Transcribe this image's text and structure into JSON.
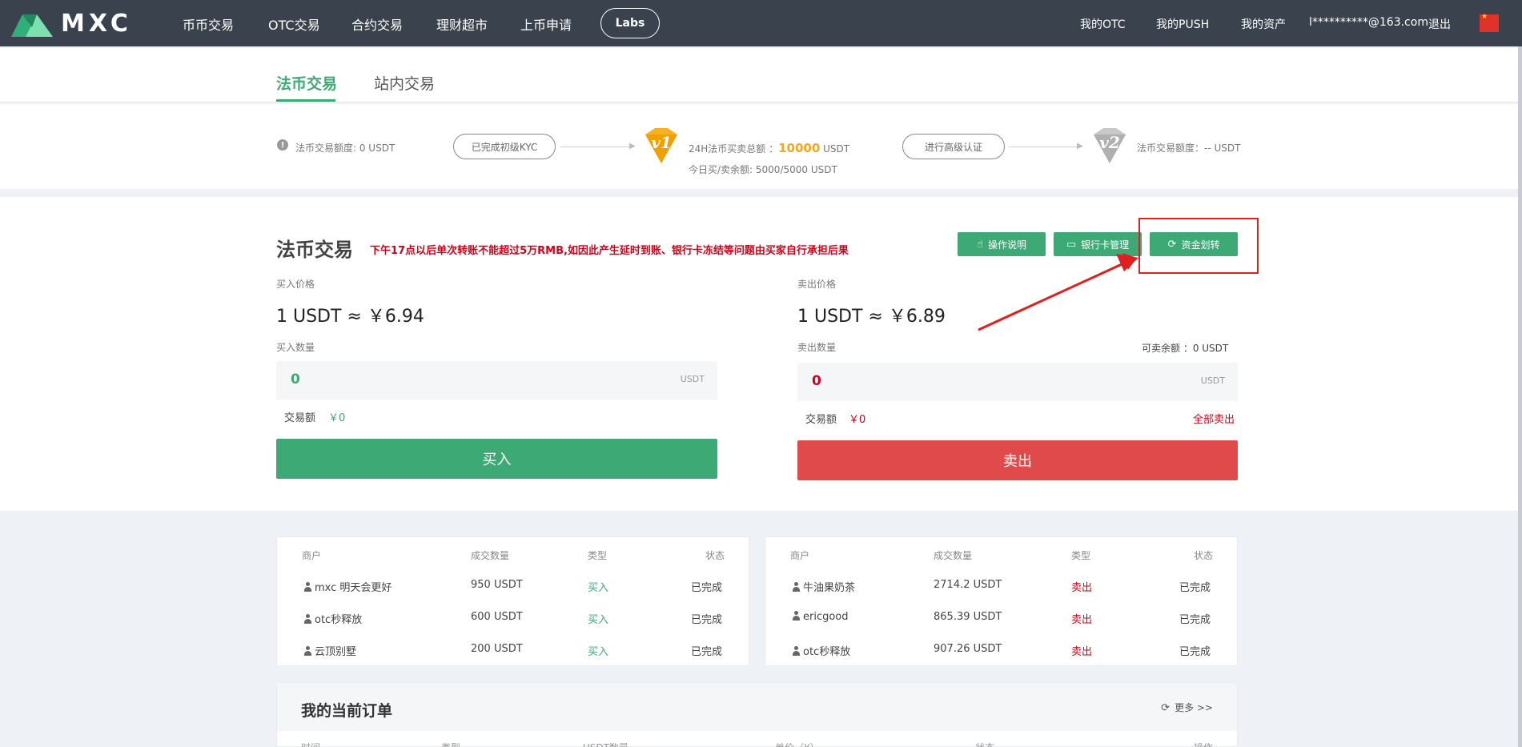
{
  "nav": {
    "logo_text": "MXC",
    "items": [
      "币币交易",
      "OTC交易",
      "合约交易",
      "理财超市",
      "上币申请"
    ],
    "labs": "Labs",
    "right": [
      "我的OTC",
      "我的PUSH",
      "我的资产",
      "l**********@163.com",
      "退出"
    ]
  },
  "tabs": {
    "fiat": "法币交易",
    "internal": "站内交易"
  },
  "kyc": {
    "limit_text": "法币交易额度: 0 USDT",
    "kyc_done": "已完成初级KYC",
    "v1": "v1",
    "total_label": "24H法币买卖总额 ：",
    "total_amount": "10000",
    "total_unit": "USDT",
    "remaining": "今日买/卖余额: 5000/5000 USDT",
    "advanced": "进行高级认证",
    "v2": "v2",
    "v2_limit": "法币交易额度：-- USDT"
  },
  "trade": {
    "title": "法币交易",
    "notice": "下午17点以后单次转账不能超过5万RMB,如因此产生延时到账、银行卡冻结等问题由买家自行承担后果",
    "btn_guide": "操作说明",
    "btn_bank": "银行卡管理",
    "btn_transfer": "资金划转",
    "buy": {
      "price_label": "买入价格",
      "price": "1 USDT ≈ ￥6.94",
      "qty_label": "买入数量",
      "qty_value": "0",
      "unit": "USDT",
      "amount_label": "交易额",
      "amount_value": "￥0",
      "button": "买入"
    },
    "sell": {
      "price_label": "卖出价格",
      "price": "1 USDT ≈ ￥6.89",
      "qty_label": "卖出数量",
      "balance": "可卖余额 ：0 USDT",
      "qty_value": "0",
      "unit": "USDT",
      "amount_label": "交易额",
      "amount_value": "￥0",
      "sell_all": "全部卖出",
      "button": "卖出"
    }
  },
  "buy_table": {
    "headers": [
      "商户",
      "成交数量",
      "类型",
      "状态"
    ],
    "rows": [
      [
        "mxc 明天会更好",
        "950 USDT",
        "买入",
        "已完成"
      ],
      [
        "otc秒释放",
        "600 USDT",
        "买入",
        "已完成"
      ],
      [
        "云顶别墅",
        "200 USDT",
        "买入",
        "已完成"
      ]
    ]
  },
  "sell_table": {
    "headers": [
      "商户",
      "成交数量",
      "类型",
      "状态"
    ],
    "rows": [
      [
        "牛油果奶茶",
        "2714.2 USDT",
        "卖出",
        "已完成"
      ],
      [
        "ericgood",
        "865.39 USDT",
        "卖出",
        "已完成"
      ],
      [
        "otc秒释放",
        "907.26 USDT",
        "卖出",
        "已完成"
      ]
    ]
  },
  "orders": {
    "title": "我的当前订单",
    "more": "更多 >>",
    "headers": [
      "时间",
      "类型",
      "USDT数量",
      "单价（¥）",
      "状态",
      "操作"
    ]
  },
  "colors": {
    "green": "#3daa76",
    "red": "#e04a4a",
    "nav_bg": "#39424d",
    "annotation": "#e02020"
  },
  "icons": [
    "hand-pointer-icon",
    "bank-card-icon",
    "refresh-icon",
    "user-icon",
    "warning-icon",
    "china-flag-icon"
  ]
}
